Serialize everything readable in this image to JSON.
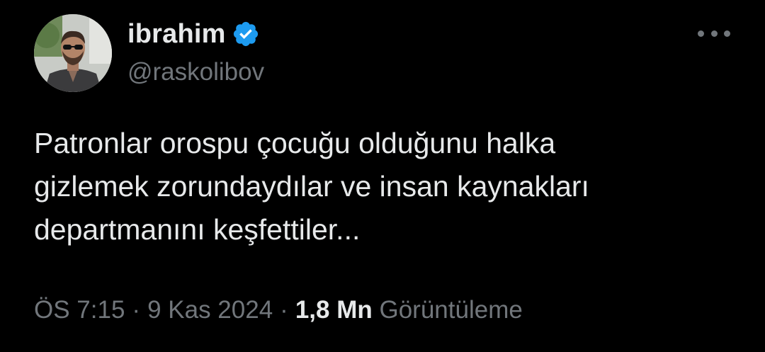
{
  "author": {
    "display_name": "ibrahim",
    "handle": "@raskolibov",
    "verified": true,
    "verified_color": "#1d9bf0",
    "avatar_icon": "profile-photo"
  },
  "tweet": {
    "lines": [
      "Patronlar orospu çocuğu olduğunu halka",
      "gizlemek zorundaydılar ve insan kaynakları",
      "departmanını keşfettiler..."
    ]
  },
  "meta": {
    "time": "ÖS 7:15",
    "date": "9 Kas 2024",
    "separator": "·",
    "views_count": "1,8 Mn",
    "views_label": "Görüntüleme"
  },
  "colors": {
    "background": "#000000",
    "primary_text": "#e7e9ea",
    "secondary_text": "#71767b"
  }
}
